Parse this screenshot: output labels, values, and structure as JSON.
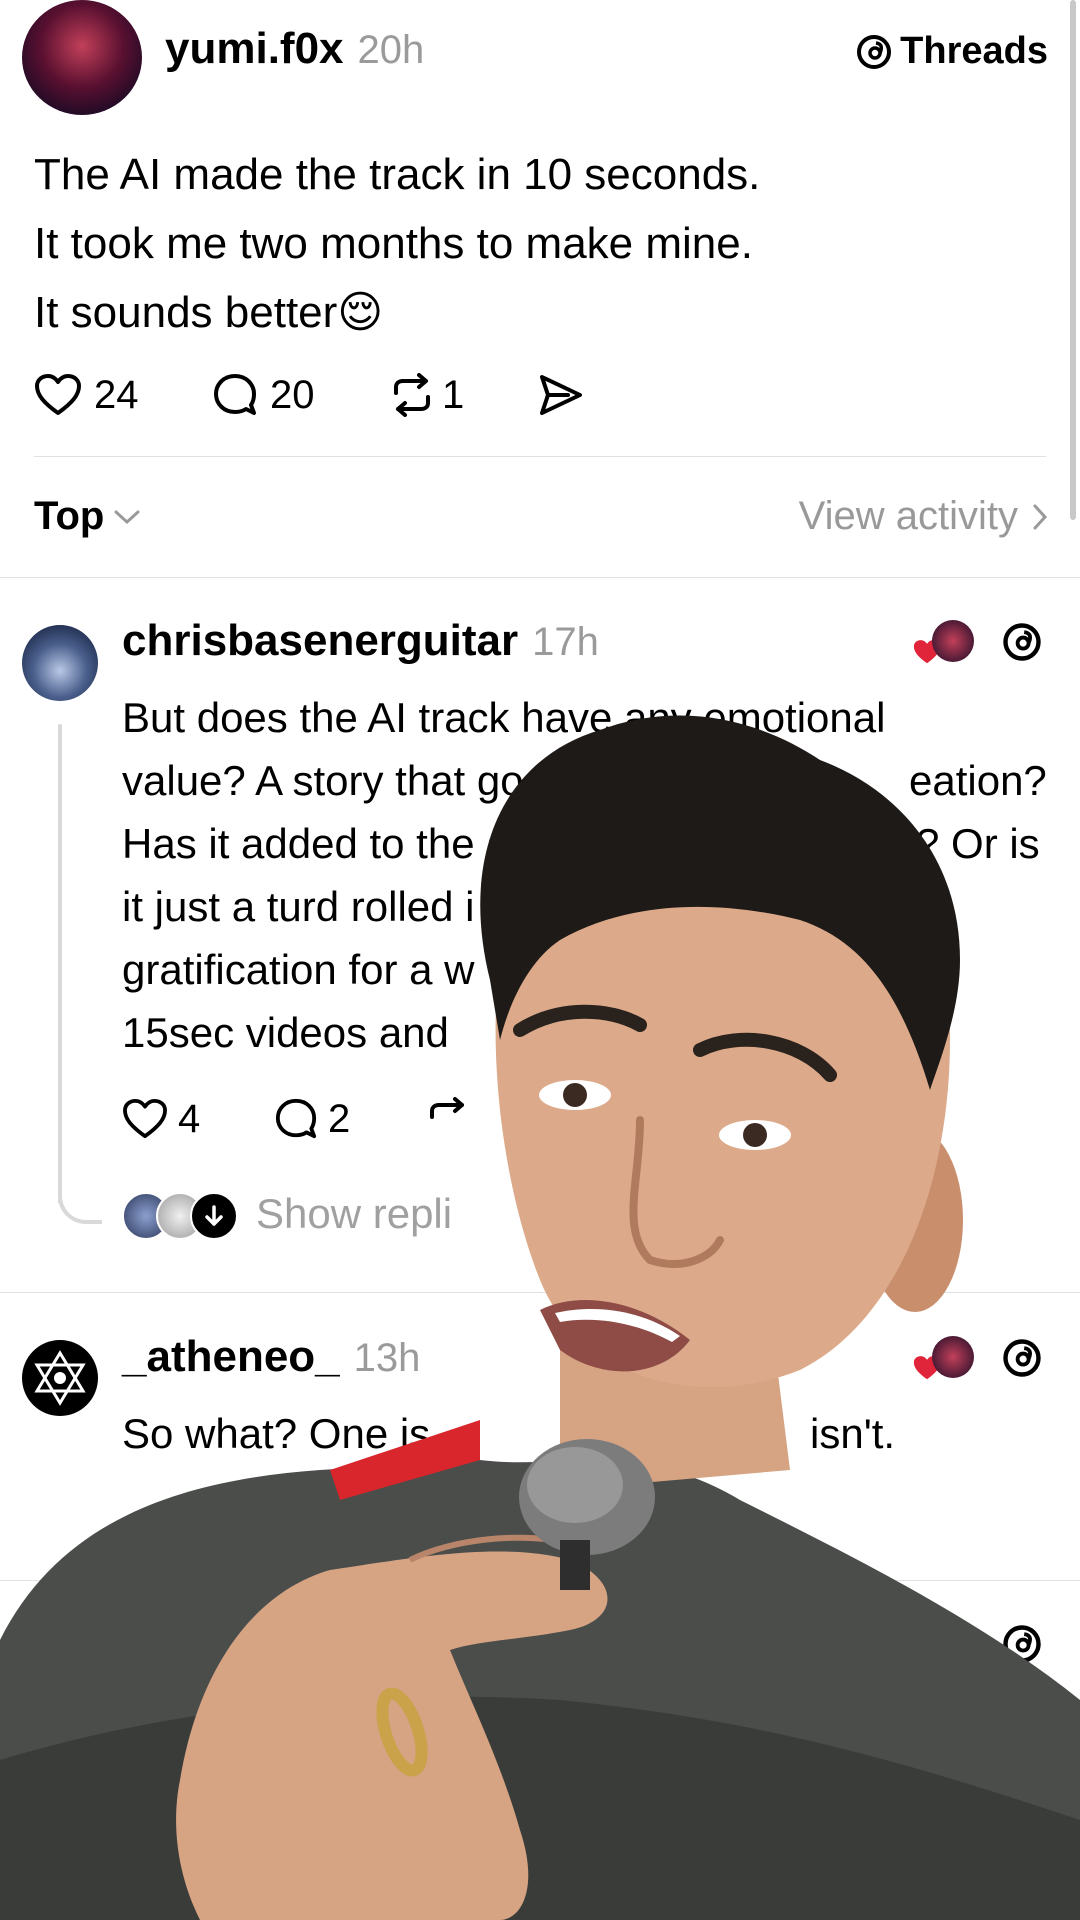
{
  "post": {
    "username": "yumi.f0x",
    "time": "20h",
    "brand": "Threads",
    "lines": [
      "The AI made the track in 10 seconds.",
      "It took me two months to make mine.",
      "It sounds better😌"
    ],
    "likes": "24",
    "comments": "20",
    "reposts": "1"
  },
  "sort": {
    "label": "Top",
    "activity": "View activity"
  },
  "replies": [
    {
      "username": "chrisbasenerguitar",
      "time": "17h",
      "lines": [
        "But does the AI track have any emotional",
        "value? A story that go",
        "eation?",
        "Has it added to the a",
        "? Or is",
        "it just a turd rolled i",
        "gratification for a w",
        "15sec videos and"
      ],
      "likes": "4",
      "comments": "2",
      "show_replies": "Show repli"
    },
    {
      "username": "_atheneo_",
      "time": "13h",
      "text_left": "So what? One is",
      "text_right": "isn't."
    }
  ],
  "colors": {
    "heart_red": "#e0243a",
    "muted": "#999999",
    "divider": "#e1e1e1"
  },
  "icons": [
    "threads-logo-icon",
    "heart-icon",
    "comment-icon",
    "repost-icon",
    "share-icon",
    "chevron-down-icon",
    "chevron-right-icon",
    "arrow-down-icon"
  ]
}
